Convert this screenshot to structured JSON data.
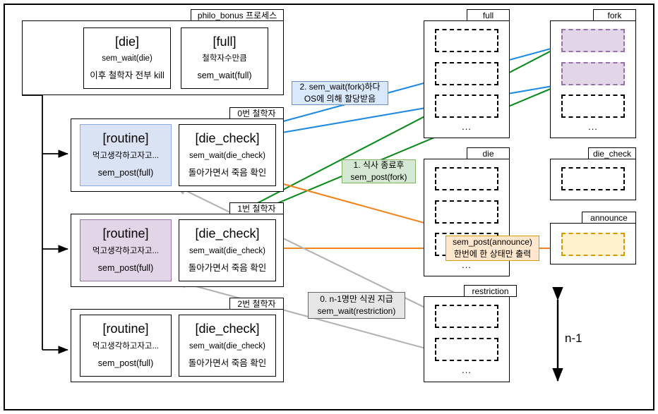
{
  "diagram": {
    "title": "philo_bonus process / semaphore interaction diagram",
    "colors": {
      "blue_accent": "#1f8ae0",
      "green_accent": "#0f8a1f",
      "orange_accent": "#ef8521",
      "gray_accent": "#b3b3b3",
      "routine_blue_fill": "#dae3f3",
      "routine_purple_fill": "#e1d5e7",
      "fork_slot_fill": "#e1d5e7",
      "announce_slot_fill": "#fff2cc"
    }
  },
  "process": {
    "tab_label": "philo_bonus 프로세스",
    "blocks": [
      {
        "title": "[die]",
        "line1": "sem_wait(die)",
        "line2": "이후 철학자 전부 kill"
      },
      {
        "title": "[full]",
        "line1": "철학자수만큼",
        "line2": "sem_wait(full)"
      }
    ]
  },
  "philosophers": [
    {
      "tab_label": "0번 철학자",
      "routine": {
        "title": "[routine]",
        "line1": "먹고생각하고자고...",
        "line2": "sem_post(full)",
        "fill": "blue"
      },
      "die_check": {
        "title": "[die_check]",
        "line1": "sem_wait(die_check)",
        "line2": "돌아가면서 죽음 확인"
      }
    },
    {
      "tab_label": "1번 철학자",
      "routine": {
        "title": "[routine]",
        "line1": "먹고생각하고자고...",
        "line2": "sem_post(full)",
        "fill": "purple"
      },
      "die_check": {
        "title": "[die_check]",
        "line1": "sem_wait(die_check)",
        "line2": "돌아가면서 죽음 확인"
      }
    },
    {
      "tab_label": "2번 철학자",
      "routine": {
        "title": "[routine]",
        "line1": "먹고생각하고자고...",
        "line2": "sem_post(full)",
        "fill": "none"
      },
      "die_check": {
        "title": "[die_check]",
        "line1": "sem_wait(die_check)",
        "line2": "돌아가면서 죽음 확인"
      }
    }
  ],
  "semaphores": [
    {
      "name": "full",
      "slots": 3,
      "highlight": 0,
      "ellipsis": "..."
    },
    {
      "name": "fork",
      "slots": 3,
      "highlight": 2,
      "ellipsis": "..."
    },
    {
      "name": "die",
      "slots": 3,
      "highlight": 0,
      "ellipsis": "..."
    },
    {
      "name": "die_check",
      "slots": 1,
      "highlight": 0,
      "ellipsis": ""
    },
    {
      "name": "announce",
      "slots": 1,
      "highlight": 1,
      "ellipsis": ""
    },
    {
      "name": "restriction",
      "slots": 2,
      "highlight": 0,
      "ellipsis": "..."
    }
  ],
  "notes": [
    {
      "id": "note-fork-wait",
      "line1": "2. sem_wait(fork)하다",
      "line2": "OS에 의해 할당받음",
      "style": "blue"
    },
    {
      "id": "note-fork-post",
      "line1": "1. 식사 종료후",
      "line2": "sem_post(fork)",
      "style": "green"
    },
    {
      "id": "note-announce",
      "line1": "sem_post(announce)",
      "line2": "한번에 한 상태만 출력",
      "style": "orange"
    },
    {
      "id": "note-restriction",
      "line1": "0. n-1명만 식권 지급",
      "line2": "sem_wait(restriction)",
      "style": "gray"
    }
  ],
  "annotations": {
    "n_minus_1": "n-1"
  }
}
